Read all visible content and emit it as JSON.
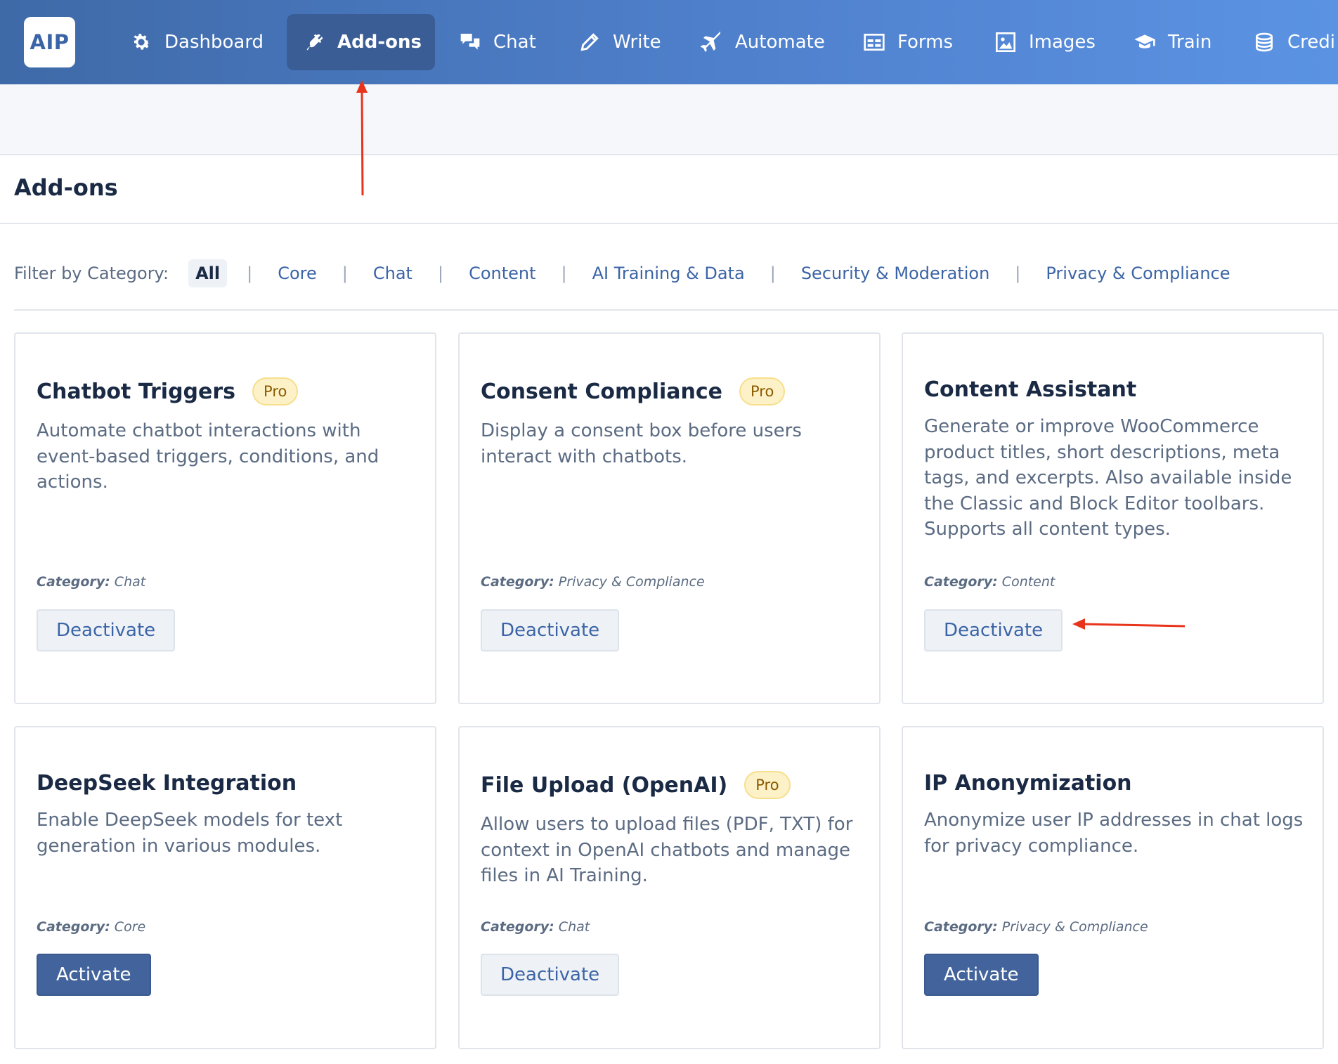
{
  "app": {
    "logo_text": "AIP"
  },
  "nav": {
    "items": [
      {
        "label": "Dashboard",
        "icon": "gear-icon",
        "active": false
      },
      {
        "label": "Add-ons",
        "icon": "plug-icon",
        "active": true
      },
      {
        "label": "Chat",
        "icon": "chat-bubbles-icon",
        "active": false
      },
      {
        "label": "Write",
        "icon": "pencil-icon",
        "active": false
      },
      {
        "label": "Automate",
        "icon": "plane-icon",
        "active": false
      },
      {
        "label": "Forms",
        "icon": "form-icon",
        "active": false
      },
      {
        "label": "Images",
        "icon": "image-icon",
        "active": false
      },
      {
        "label": "Train",
        "icon": "graduation-cap-icon",
        "active": false
      },
      {
        "label": "Credi",
        "icon": "coins-icon",
        "active": false
      }
    ]
  },
  "page": {
    "title": "Add-ons"
  },
  "filter": {
    "label": "Filter by Category:",
    "separator": "|",
    "categories": [
      "All",
      "Core",
      "Chat",
      "Content",
      "AI Training & Data",
      "Security & Moderation",
      "Privacy & Compliance"
    ],
    "active": "All"
  },
  "addons": [
    {
      "title": "Chatbot Triggers",
      "badge": "Pro",
      "description": "Automate chatbot interactions with event-based triggers, conditions, and actions.",
      "category_label": "Category:",
      "category": "Chat",
      "button": "Deactivate",
      "status": "active"
    },
    {
      "title": "Consent Compliance",
      "badge": "Pro",
      "description": "Display a consent box before users interact with chatbots.",
      "category_label": "Category:",
      "category": "Privacy & Compliance",
      "button": "Deactivate",
      "status": "active"
    },
    {
      "title": "Content Assistant",
      "badge": "",
      "description": "Generate or improve WooCommerce product titles, short descriptions, meta tags, and excerpts. Also available inside the Classic and Block Editor toolbars. Supports all content types.",
      "category_label": "Category:",
      "category": "Content",
      "button": "Deactivate",
      "status": "active"
    },
    {
      "title": "DeepSeek Integration",
      "badge": "",
      "description": "Enable DeepSeek models for text generation in various modules.",
      "category_label": "Category:",
      "category": "Core",
      "button": "Activate",
      "status": "inactive"
    },
    {
      "title": "File Upload (OpenAI)",
      "badge": "Pro",
      "description": "Allow users to upload files (PDF, TXT) for context in OpenAI chatbots and manage files in AI Training.",
      "category_label": "Category:",
      "category": "Chat",
      "button": "Deactivate",
      "status": "active"
    },
    {
      "title": "IP Anonymization",
      "badge": "",
      "description": "Anonymize user IP addresses in chat logs for privacy compliance.",
      "category_label": "Category:",
      "category": "Privacy & Compliance",
      "button": "Activate",
      "status": "inactive"
    }
  ],
  "colors": {
    "annotation_arrow": "#e8341c",
    "primary": "#42639b",
    "nav_gradient_start": "#3f6aa8",
    "nav_gradient_end": "#5b93e3"
  }
}
